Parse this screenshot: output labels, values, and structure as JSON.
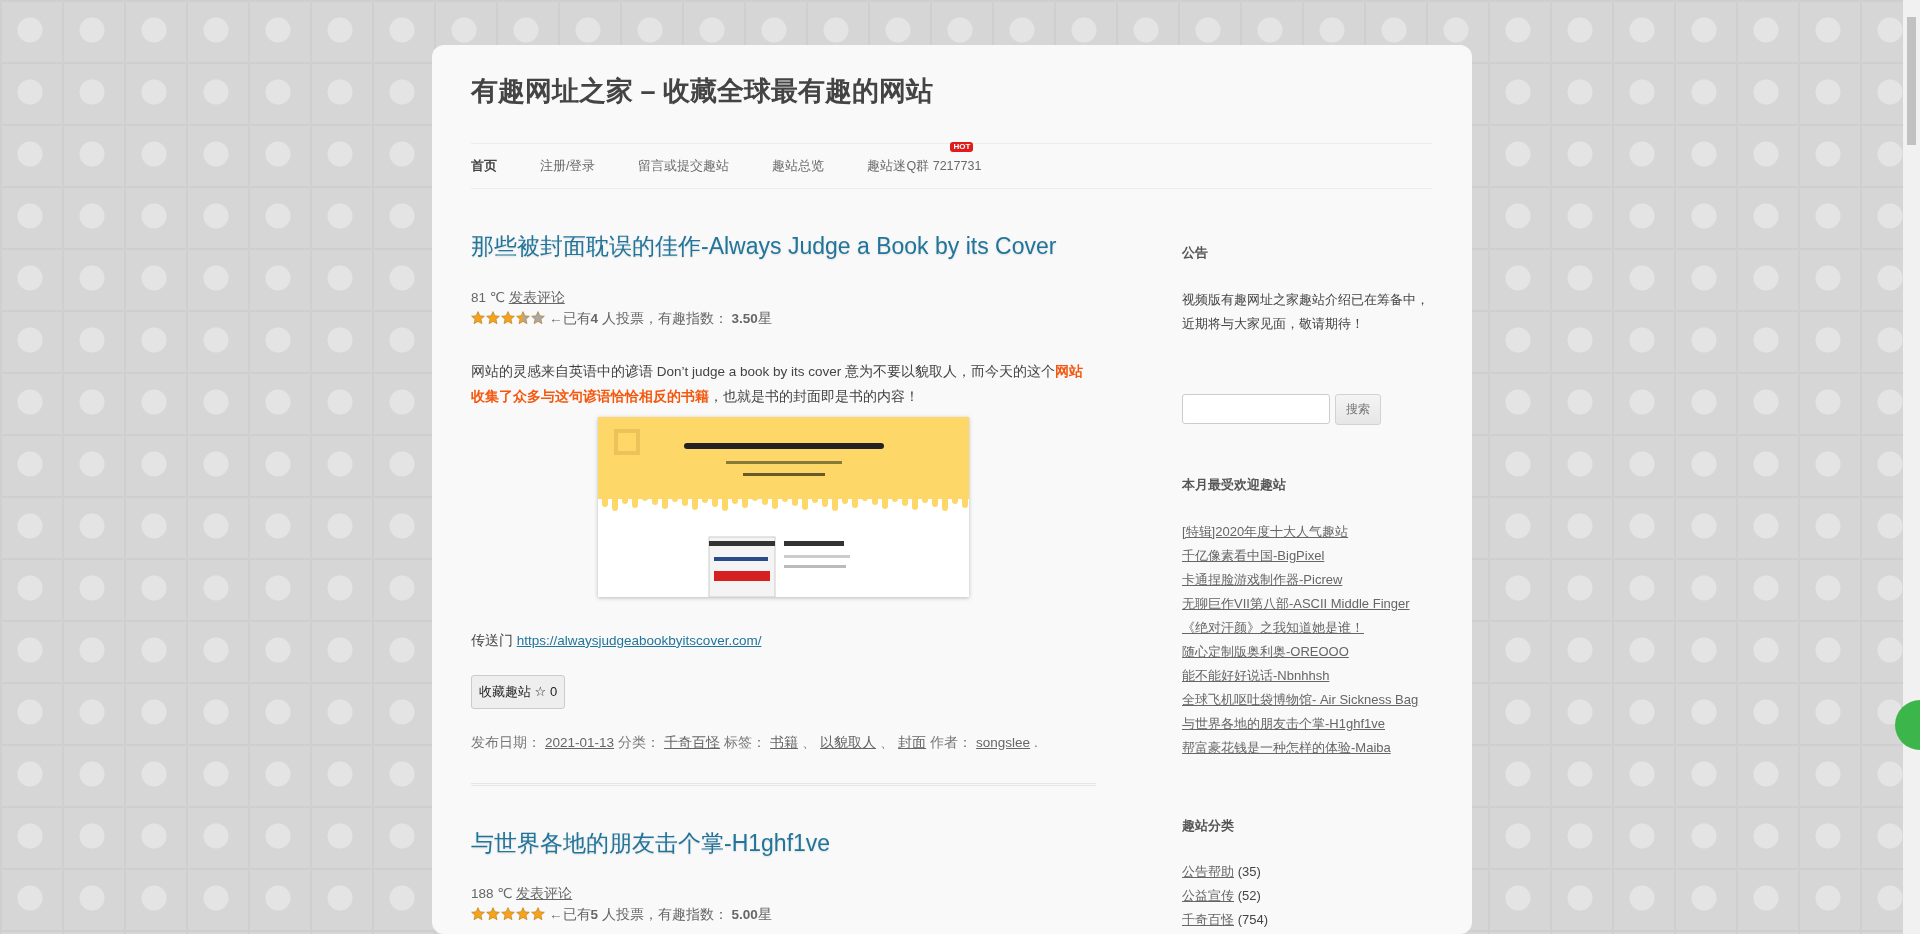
{
  "site": {
    "title": "有趣网址之家 – 收藏全球最有趣的网站"
  },
  "nav": [
    {
      "label": "首页",
      "selected": true
    },
    {
      "label": "注册/登录",
      "selected": false
    },
    {
      "label": "留言或提交趣站",
      "selected": false
    },
    {
      "label": "趣站总览",
      "selected": false
    },
    {
      "label": "趣站迷Q群 7217731",
      "selected": false,
      "badge": "HOT"
    }
  ],
  "posts": [
    {
      "title": "那些被封面耽误的佳作-Always Judge a Book by its Cover",
      "heat": "81 ℃",
      "comment": "发表评论",
      "stars": 3.5,
      "votes": "←已有**4** 人投票，有趣指数： **3.50**星",
      "body": "网站的灵感来自英语中的谚语 Don’t judge a book by its cover 意为不要以貌取人，而今天的这个**网站收集了众多与这句谚语恰恰相反的书籍**，也就是书的封面即是书的内容！",
      "portal_label": "传送门",
      "url": "https://alwaysjudgeabookbyitscover.com/",
      "fav_button": "收藏趣站 ☆ 0",
      "footer": [
        {
          "kind": "label",
          "text": "发布日期："
        },
        {
          "kind": "link",
          "text": "2021-01-13"
        },
        {
          "kind": "label",
          "text": "分类："
        },
        {
          "kind": "link",
          "text": "千奇百怪"
        },
        {
          "kind": "label",
          "text": "标签："
        },
        {
          "kind": "link",
          "text": "书籍"
        },
        {
          "kind": "sep",
          "text": "、"
        },
        {
          "kind": "link",
          "text": "以貌取人"
        },
        {
          "kind": "sep",
          "text": "、"
        },
        {
          "kind": "link",
          "text": "封面"
        },
        {
          "kind": "label",
          "text": "作者："
        },
        {
          "kind": "link",
          "text": "songslee"
        },
        {
          "kind": "sep",
          "text": "."
        }
      ]
    },
    {
      "title": "与世界各地的朋友击个掌-H1ghf1ve",
      "heat": "188 ℃",
      "comment": "发表评论",
      "stars": 5,
      "votes": "←已有**5** 人投票，有趣指数： **5.00**星"
    }
  ],
  "sidebar": [
    {
      "kind": "text",
      "title": "公告",
      "body": "视频版有趣网址之家趣站介绍已在筹备中，近期将与大家见面，敬请期待！"
    },
    {
      "kind": "search",
      "button": "搜索"
    },
    {
      "kind": "links",
      "title": "本月最受欢迎趣站",
      "items": [
        "[特辑]2020年度十大人气趣站",
        "千亿像素看中国-BigPixel",
        "卡通捏脸游戏制作器-Picrew",
        "无聊巨作VII第八部-ASCII Middle Finger",
        "《绝对汗颜》之我知道她是谁！",
        "随心定制版奥利奥-OREOOO",
        "能不能好好说话-Nbnhhsh",
        "全球飞机呕吐袋博物馆- Air Sickness Bag",
        "与世界各地的朋友击个掌-H1ghf1ve",
        "帮富豪花钱是一种怎样的体验-Maiba"
      ]
    },
    {
      "kind": "categories",
      "title": "趣站分类",
      "items": [
        {
          "name": "公告帮助",
          "count": "(35)"
        },
        {
          "name": "公益宣传",
          "count": "(52)"
        },
        {
          "name": "千奇百怪",
          "count": "(754)"
        }
      ]
    }
  ]
}
